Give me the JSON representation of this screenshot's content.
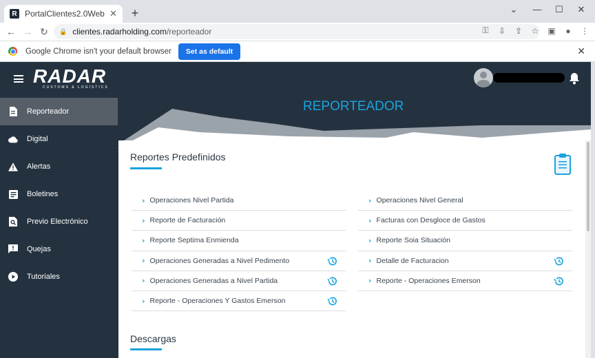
{
  "browser": {
    "tab_title": "PortalClientes2.0Web",
    "favicon_letter": "R",
    "new_tab": "+",
    "url_host": "clientes.radarholding.com",
    "url_path": "/reporteador",
    "infobar_text": "Google Chrome isn't your default browser",
    "infobar_button": "Set as default",
    "icons": [
      "back-arrow",
      "forward-arrow",
      "reload",
      "lock",
      "key",
      "install",
      "share",
      "star",
      "sidebar",
      "profile",
      "menu"
    ]
  },
  "header": {
    "logo_text": "RADAR",
    "logo_subtext": "CUSTOMS & LOGISTICS"
  },
  "sidebar": {
    "items": [
      {
        "label": "Reporteador",
        "icon": "document-icon",
        "active": true
      },
      {
        "label": "Digital",
        "icon": "cloud-icon"
      },
      {
        "label": "Alertas",
        "icon": "warning-icon"
      },
      {
        "label": "Boletines",
        "icon": "newspaper-icon"
      },
      {
        "label": "Previo Electrónico",
        "icon": "search-document-icon"
      },
      {
        "label": "Quejas",
        "icon": "feedback-icon"
      },
      {
        "label": "Tutoriales",
        "icon": "play-icon"
      }
    ]
  },
  "banner": {
    "title": "REPORTEADOR"
  },
  "reports": {
    "title": "Reportes Predefinidos",
    "left": [
      {
        "label": "Operaciones Nivel Partida",
        "history": false
      },
      {
        "label": "Reporte de Facturación",
        "history": false
      },
      {
        "label": "Reporte Septima Enmienda",
        "history": false
      },
      {
        "label": "Operaciones Generadas a Nivel Pedimento",
        "history": true
      },
      {
        "label": "Operaciones Generadas a Nivel Partida",
        "history": true
      },
      {
        "label": "Reporte - Operaciones Y Gastos Emerson",
        "history": true
      }
    ],
    "right": [
      {
        "label": "Operaciones Nivel General",
        "history": false
      },
      {
        "label": "Facturas con Desgloce de Gastos",
        "history": false
      },
      {
        "label": "Reporte Soia Situación",
        "history": false
      },
      {
        "label": "Detalle de Facturacion",
        "history": true
      },
      {
        "label": "Reporte - Operaciones Emerson",
        "history": true
      }
    ]
  },
  "downloads": {
    "title": "Descargas"
  },
  "colors": {
    "accent": "#1ba3dd",
    "navy": "#243240",
    "sidebar_active": "#565f68",
    "button_blue": "#1a73e8"
  }
}
